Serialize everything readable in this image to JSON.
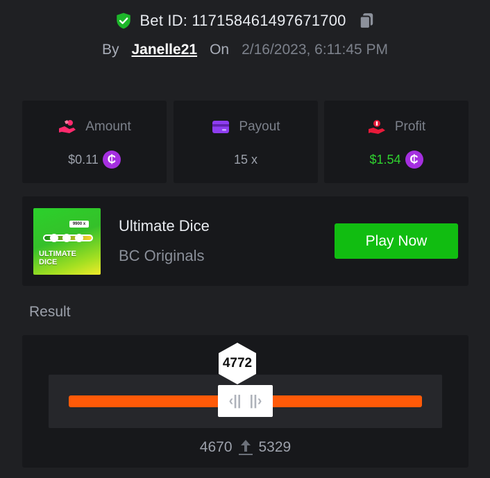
{
  "header": {
    "bet_id_label": "Bet ID: 117158461497671700",
    "by_label": "By",
    "username": "Janelle21",
    "on_label": "On",
    "datetime": "2/16/2023, 6:11:45 PM"
  },
  "stats": {
    "amount": {
      "label": "Amount",
      "value": "$0.11",
      "coin_symbol": "₵"
    },
    "payout": {
      "label": "Payout",
      "value": "15 x"
    },
    "profit": {
      "label": "Profit",
      "value": "$1.54",
      "coin_symbol": "₵"
    }
  },
  "game": {
    "name": "Ultimate Dice",
    "provider": "BC Originals",
    "thumb_title_line1": "ULTIMATE",
    "thumb_title_line2": "DICE",
    "thumb_tag": "9900 x",
    "play_label": "Play Now"
  },
  "result": {
    "label": "Result",
    "value": "4772",
    "range_low": "4670",
    "range_high": "5329"
  },
  "colors": {
    "accent_green": "#11bd11",
    "profit_green": "#2fd12f",
    "track_orange": "#ff5a08",
    "coin_purple": "#a52fe0",
    "amount_pink": "#ff2a6d",
    "payout_purple": "#8e3df0",
    "profit_red": "#e81a3a"
  },
  "icons": {
    "shield": "shield-check-icon",
    "copy": "copy-icon",
    "amount": "hand-coins-icon",
    "payout": "card-icon",
    "profit": "hand-money-icon",
    "coin": "coin-icon",
    "arrow": "arrow-up-icon"
  }
}
